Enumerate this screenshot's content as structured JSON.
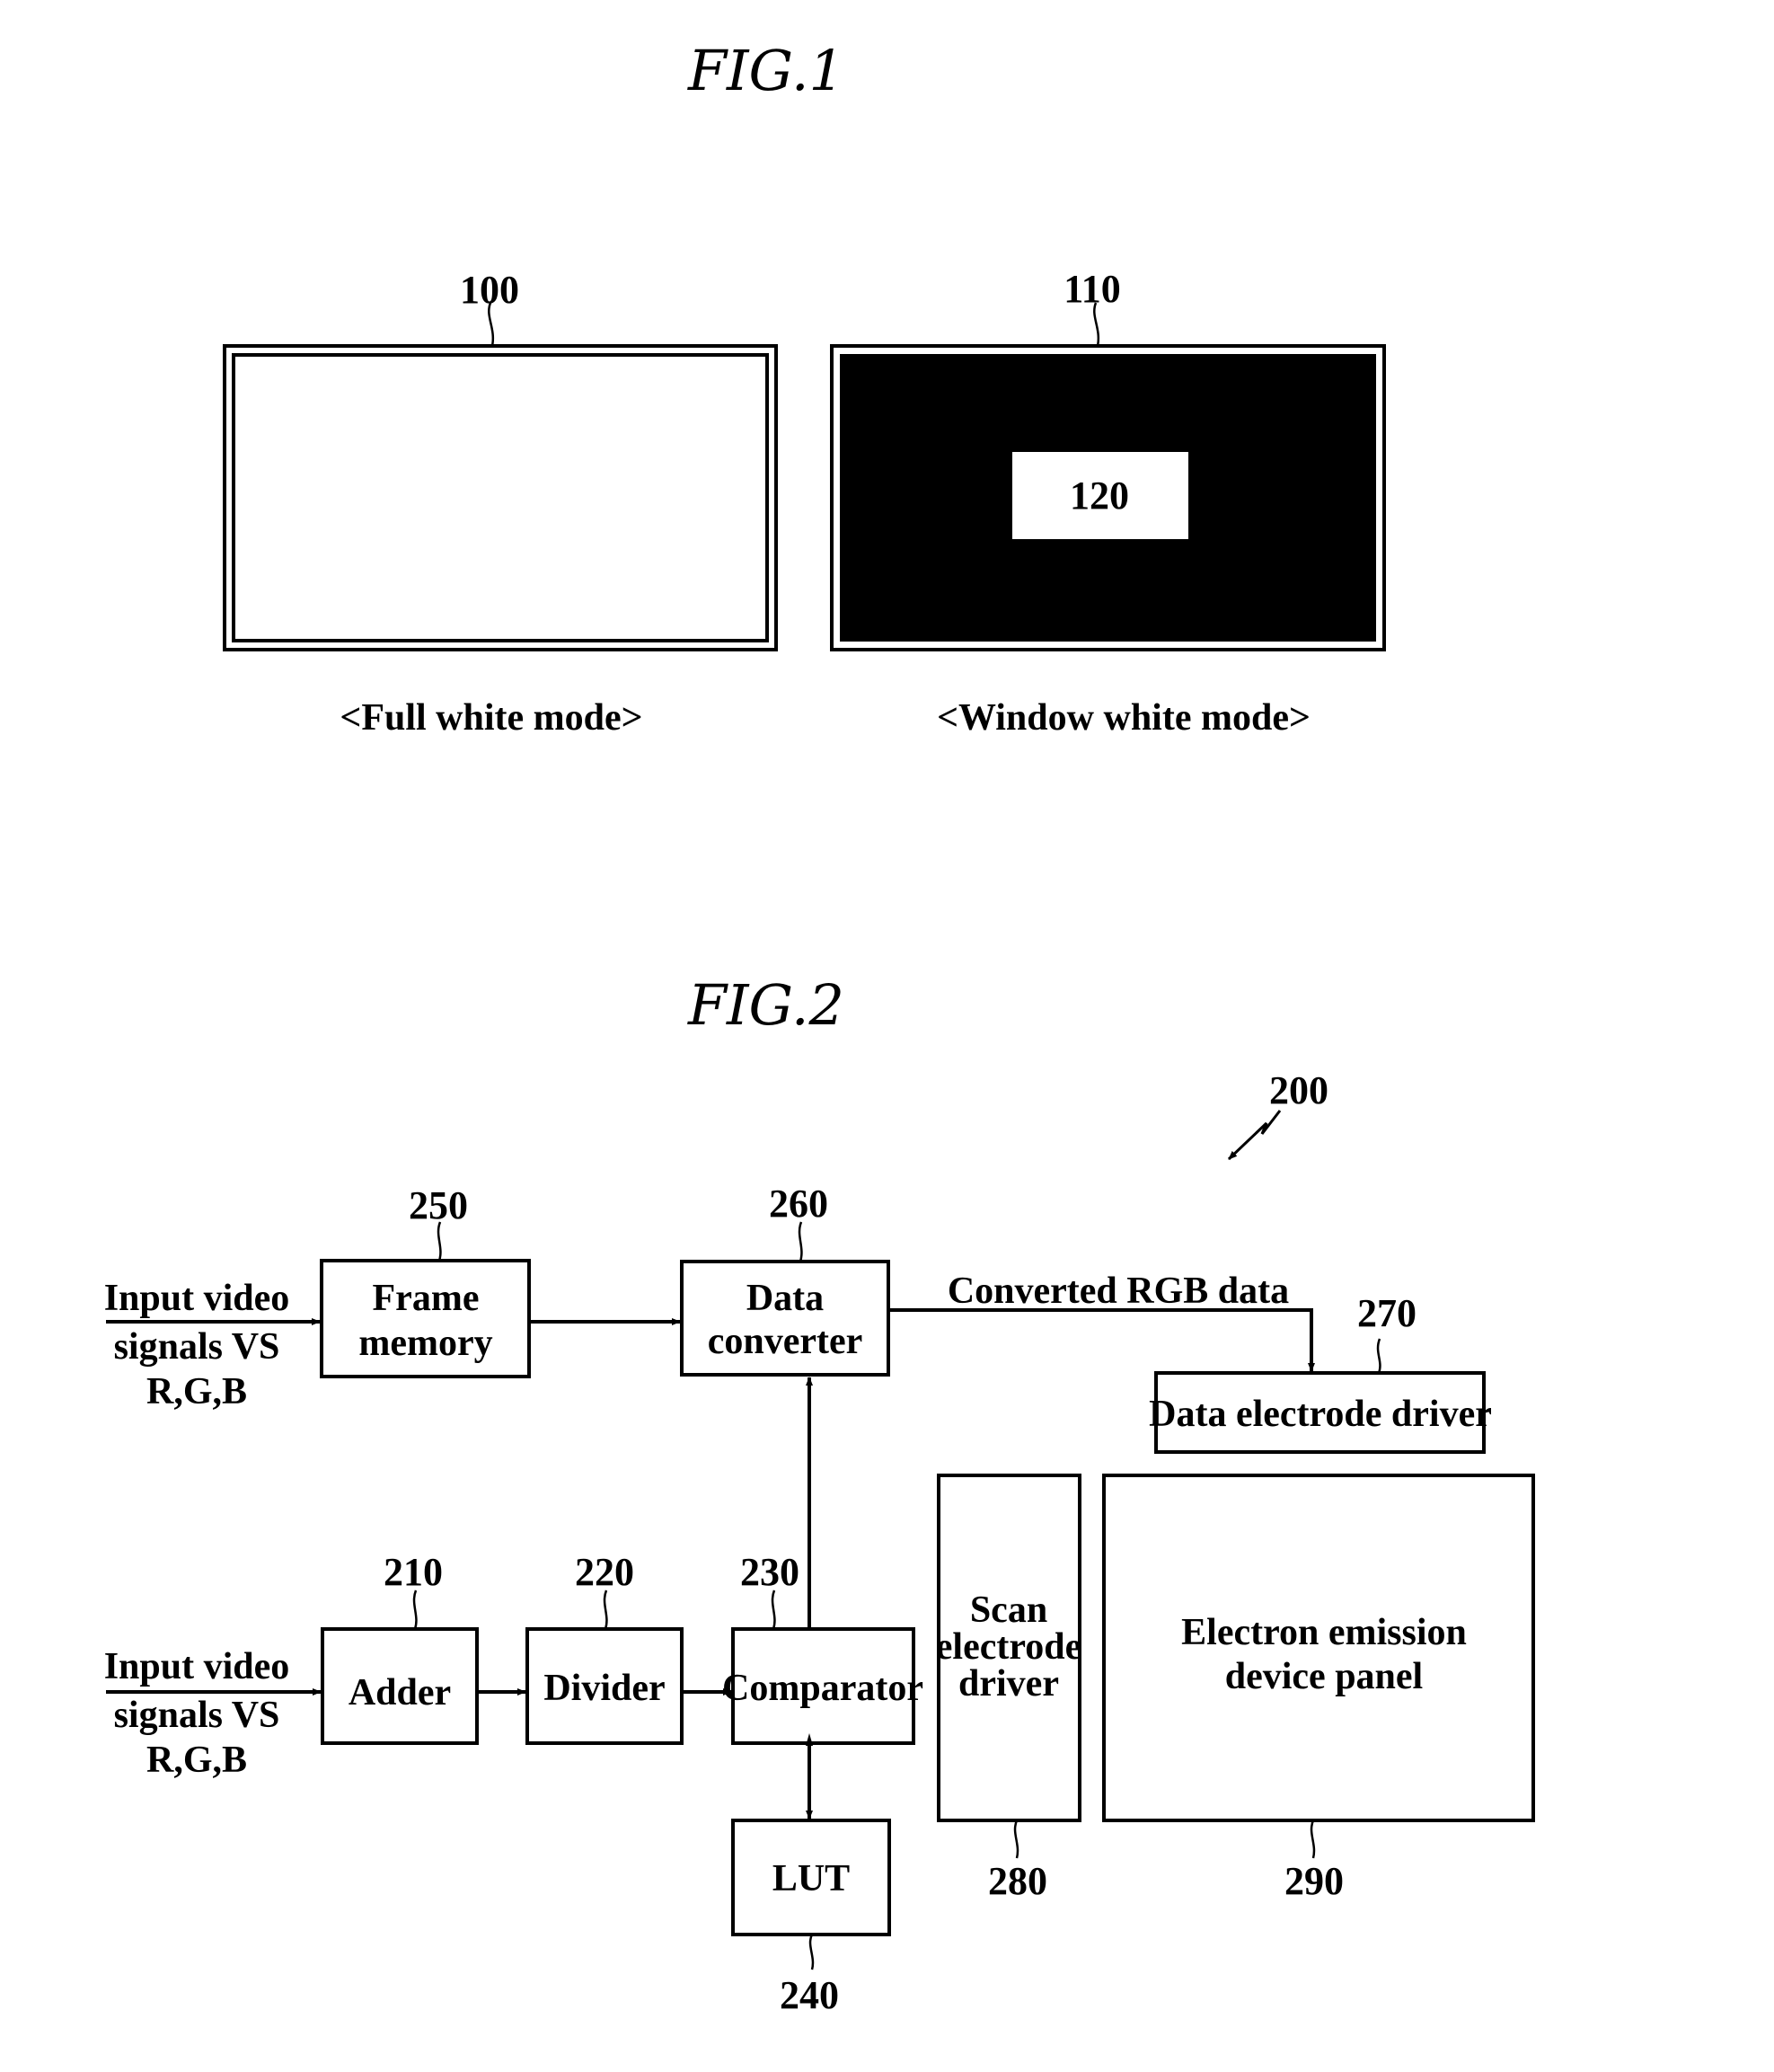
{
  "fig1": {
    "title": "FIG.1",
    "panels": [
      {
        "ref": "100",
        "caption": "<Full white mode>"
      },
      {
        "ref": "110",
        "caption": "<Window white mode>",
        "window_ref": "120"
      }
    ]
  },
  "fig2": {
    "title": "FIG.2",
    "system_ref": "200",
    "input1": {
      "lines": [
        "Input video",
        "signals VS",
        "R,G,B"
      ]
    },
    "input2": {
      "lines": [
        "Input video",
        "signals VS",
        "R,G,B"
      ]
    },
    "blocks": {
      "frame_memory": {
        "ref": "250",
        "lines": [
          "Frame",
          "memory"
        ]
      },
      "data_converter": {
        "ref": "260",
        "lines": [
          "Data",
          "converter"
        ]
      },
      "data_electrode_driver": {
        "ref": "270",
        "lines": [
          "Data electrode driver"
        ]
      },
      "scan_electrode_driver": {
        "ref": "280",
        "lines": [
          "Scan",
          "electrode",
          "driver"
        ]
      },
      "panel": {
        "ref": "290",
        "lines": [
          "Electron emission",
          "device panel"
        ]
      },
      "adder": {
        "ref": "210",
        "lines": [
          "Adder"
        ]
      },
      "divider": {
        "ref": "220",
        "lines": [
          "Divider"
        ]
      },
      "comparator": {
        "ref": "230",
        "lines": [
          "Comparator"
        ]
      },
      "lut": {
        "ref": "240",
        "lines": [
          "LUT"
        ]
      }
    },
    "converted_label": "Converted RGB data"
  }
}
